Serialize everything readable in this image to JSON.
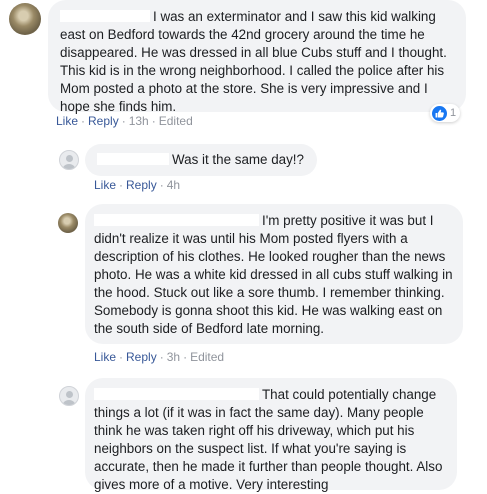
{
  "comments": [
    {
      "author_hidden": true,
      "avatar": "photo",
      "text": "I was an exterminator and I saw this kid walking east on Bedford towards the 42nd grocery around the time he disappeared. He was dressed in all blue Cubs stuff and I thought. This kid is in the wrong neighborhood. I called the police after his Mom posted a photo at the store. She is very impressive and I hope she finds him.",
      "like": "Like",
      "reply": "Reply",
      "time": "13h",
      "edited": "Edited",
      "reaction_count": "1"
    },
    {
      "author_hidden": true,
      "avatar": "blank",
      "text": "Was it the same day!?",
      "like": "Like",
      "reply": "Reply",
      "time": "4h"
    },
    {
      "author_hidden": true,
      "avatar": "photo",
      "text": "I'm pretty positive it was but I didn't realize it was until his Mom posted flyers with a description of his clothes. He looked rougher than the news photo. He was a white kid dressed in all cubs stuff walking in the hood. Stuck out like a sore thumb. I remember thinking. Somebody is gonna shoot this kid. He was walking east on the south side of Bedford late morning.",
      "like": "Like",
      "reply": "Reply",
      "time": "3h",
      "edited": "Edited"
    },
    {
      "author_hidden": true,
      "avatar": "blank",
      "text": "That could potentially change things a lot (if it was in fact the same day). Many people think he was taken right off his driveway, which put his neighbors on the suspect list. If what you're saying is accurate, then he made it further than people thought. Also gives more of a motive. Very interesting"
    }
  ],
  "colors": {
    "bubble": "#f2f3f5",
    "link": "#385898",
    "meta": "#90949c",
    "like_badge": "#1877f2"
  },
  "icons": {
    "reaction": "thumbs-up-icon",
    "avatar_blank": "default-avatar-icon",
    "avatar_photo": "profile-photo-icon"
  }
}
